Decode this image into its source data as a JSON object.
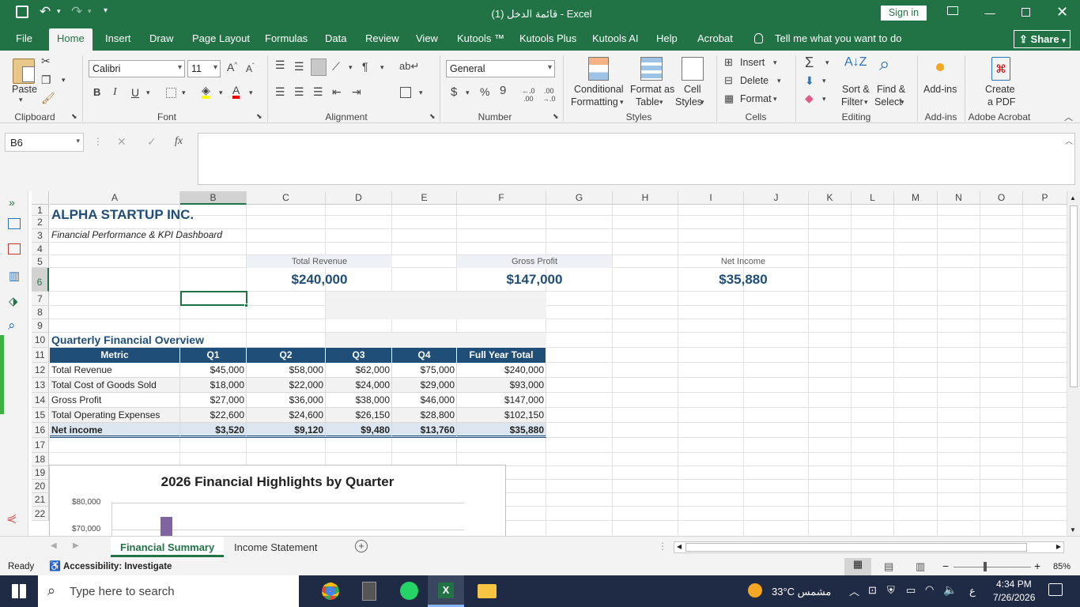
{
  "window": {
    "title": "قائمة الدخل (1)  -  Excel",
    "sign_in": "Sign in"
  },
  "menu": {
    "tabs": [
      "File",
      "Home",
      "Insert",
      "Draw",
      "Page Layout",
      "Formulas",
      "Data",
      "Review",
      "View",
      "Kutools ™",
      "Kutools Plus",
      "Kutools AI",
      "Help",
      "Acrobat"
    ],
    "tell_me": "Tell me what you want to do",
    "share": "Share"
  },
  "ribbon": {
    "clipboard": {
      "label": "Clipboard",
      "paste": "Paste"
    },
    "font": {
      "label": "Font",
      "name": "Calibri",
      "size": "11",
      "bold": "B",
      "italic": "I",
      "underline": "U"
    },
    "alignment": {
      "label": "Alignment"
    },
    "number": {
      "label": "Number",
      "format": "General",
      "currency": "$",
      "percent": "%"
    },
    "styles": {
      "label": "Styles",
      "cond1": "Conditional",
      "cond2": "Formatting",
      "fmt1": "Format as",
      "fmt2": "Table",
      "cell1": "Cell",
      "cell2": "Styles"
    },
    "cells": {
      "label": "Cells",
      "insert": "Insert",
      "delete": "Delete",
      "format": "Format"
    },
    "editing": {
      "label": "Editing",
      "sort1": "Sort &",
      "sort2": "Filter",
      "find1": "Find &",
      "find2": "Select"
    },
    "addins": {
      "label": "Add-ins",
      "btn": "Add-ins"
    },
    "acrobat": {
      "label": "Adobe Acrobat",
      "c1": "Create",
      "c2": "a PDF"
    }
  },
  "formula_bar": {
    "name_box": "B6",
    "fx": "fx",
    "value": ""
  },
  "columns": [
    "A",
    "B",
    "C",
    "D",
    "E",
    "F",
    "G",
    "H",
    "I",
    "J",
    "K",
    "L",
    "M",
    "N",
    "O",
    "P"
  ],
  "rows": [
    "1",
    "2",
    "3",
    "4",
    "5",
    "6",
    "7",
    "8",
    "9",
    "10",
    "11",
    "12",
    "13",
    "14",
    "15",
    "16",
    "17",
    "18",
    "19",
    "20",
    "21",
    "22"
  ],
  "sheet": {
    "title": "ALPHA STARTUP INC.",
    "subtitle": "Financial Performance & KPI Dashboard",
    "kpi": [
      {
        "label": "Total Revenue",
        "value": "$240,000"
      },
      {
        "label": "Gross Profit",
        "value": "$147,000"
      },
      {
        "label": "Net Income",
        "value": "$35,880"
      }
    ],
    "section": "Quarterly Financial Overview",
    "table": {
      "headers": [
        "Metric",
        "Q1",
        "Q2",
        "Q3",
        "Q4",
        "Full Year Total"
      ],
      "rows": [
        [
          "Total Revenue",
          "$45,000",
          "$58,000",
          "$62,000",
          "$75,000",
          "$240,000"
        ],
        [
          "Total Cost of Goods Sold",
          "$18,000",
          "$22,000",
          "$24,000",
          "$29,000",
          "$93,000"
        ],
        [
          "Gross Profit",
          "$27,000",
          "$36,000",
          "$38,000",
          "$46,000",
          "$147,000"
        ],
        [
          "Total Operating Expenses",
          "$22,600",
          "$24,600",
          "$26,150",
          "$28,800",
          "$102,150"
        ],
        [
          "Net income",
          "$3,520",
          "$9,120",
          "$9,480",
          "$13,760",
          "$35,880"
        ]
      ]
    }
  },
  "chart_data": {
    "type": "bar",
    "title": "2026 Financial Highlights by Quarter",
    "y_ticks": [
      "$80,000",
      "$70,000"
    ],
    "bar_color": "#8064a2"
  },
  "sheet_tabs": {
    "active": "Financial Summary",
    "other": "Income Statement"
  },
  "status": {
    "ready": "Ready",
    "accessibility": "Accessibility: Investigate",
    "zoom": "85%"
  },
  "taskbar": {
    "search": "Type here to search",
    "weather": "33°C  مشمس",
    "time": "4:34 PM",
    "date": "7/26/2026",
    "lang": "ع"
  }
}
